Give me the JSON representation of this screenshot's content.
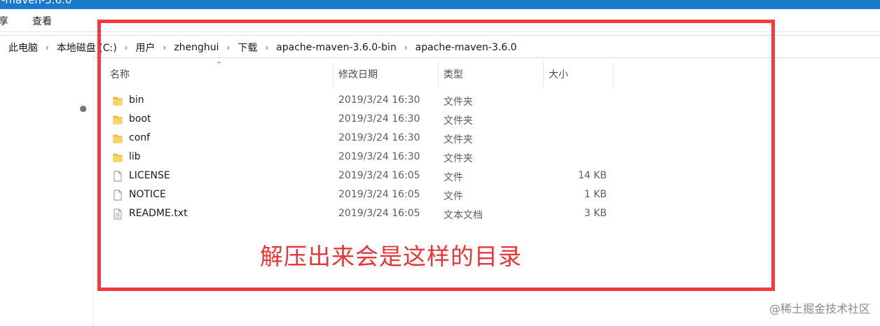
{
  "window": {
    "title": "-maven-3.6.0"
  },
  "ribbon": {
    "tabs": [
      "享",
      "查看"
    ]
  },
  "breadcrumb": [
    "此电脑",
    "本地磁盘 (C:)",
    "用户",
    "zhenghui",
    "下载",
    "apache-maven-3.6.0-bin",
    "apache-maven-3.6.0"
  ],
  "columns": {
    "name": "名称",
    "date": "修改日期",
    "type": "类型",
    "size": "大小"
  },
  "files": [
    {
      "name": "bin",
      "date": "2019/3/24 16:30",
      "type": "文件夹",
      "size": "",
      "icon": "folder-icon"
    },
    {
      "name": "boot",
      "date": "2019/3/24 16:30",
      "type": "文件夹",
      "size": "",
      "icon": "folder-icon"
    },
    {
      "name": "conf",
      "date": "2019/3/24 16:30",
      "type": "文件夹",
      "size": "",
      "icon": "folder-icon"
    },
    {
      "name": "lib",
      "date": "2019/3/24 16:30",
      "type": "文件夹",
      "size": "",
      "icon": "folder-icon"
    },
    {
      "name": "LICENSE",
      "date": "2019/3/24 16:05",
      "type": "文件",
      "size": "14 KB",
      "icon": "file-icon"
    },
    {
      "name": "NOTICE",
      "date": "2019/3/24 16:05",
      "type": "文件",
      "size": "1 KB",
      "icon": "file-icon"
    },
    {
      "name": "README.txt",
      "date": "2019/3/24 16:05",
      "type": "文本文档",
      "size": "3 KB",
      "icon": "text-file-icon"
    }
  ],
  "annotation": "解压出来会是这样的目录",
  "watermark": "@稀土掘金技术社区",
  "colors": {
    "titlebar": "#1979ca",
    "annotation_red": "#f23a3f",
    "folder": "#f4c542"
  }
}
